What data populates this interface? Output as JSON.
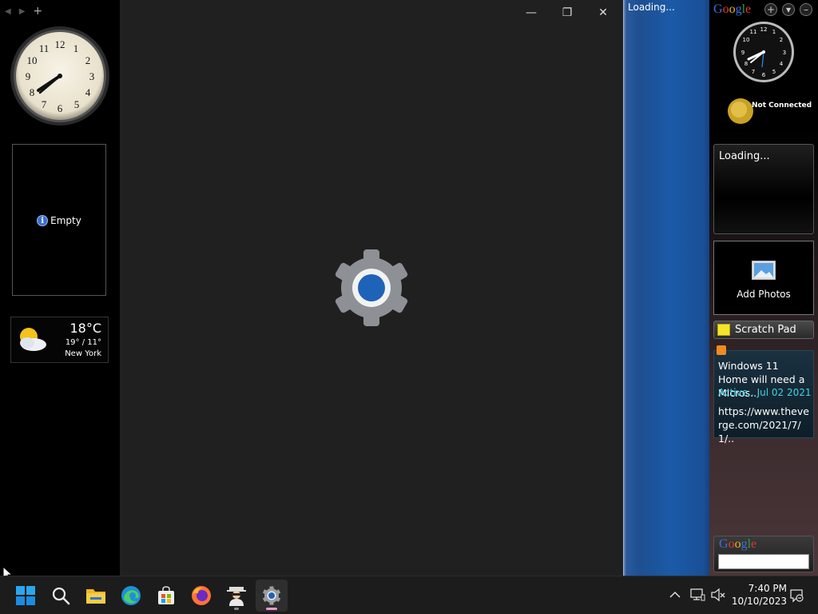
{
  "left_sidebar": {
    "slideshow": {
      "empty_label": "Empty"
    },
    "weather": {
      "temp": "18°C",
      "range": "19° / 11°",
      "city": "New York"
    }
  },
  "settings_window": {
    "minimize_glyph": "—",
    "maximize_glyph": "❐",
    "close_glyph": "✕"
  },
  "blue_panel": {
    "loading_text": "Loading..."
  },
  "google_sidebar": {
    "logo": [
      "G",
      "o",
      "o",
      "g",
      "l",
      "e"
    ],
    "add_glyph": "+",
    "menu_glyph": "▾",
    "collapse_glyph": "–",
    "connection_status": "Not Connected",
    "loading_gadget_text": "Loading...",
    "photos_label": "Add Photos",
    "scratch_pad_label": "Scratch Pad",
    "rss": {
      "headline": "Windows 11 Home will need a Micros..",
      "meta": "Active..   Jul 02 2021",
      "url": "https://www.theverge.com/2021/7/1/.."
    },
    "search": {
      "value": ""
    }
  },
  "taskbar": {
    "apps": [
      {
        "name": "start-button"
      },
      {
        "name": "search-icon"
      },
      {
        "name": "file-explorer-icon"
      },
      {
        "name": "edge-icon"
      },
      {
        "name": "store-icon"
      },
      {
        "name": "firefox-icon"
      },
      {
        "name": "spy-app-icon"
      },
      {
        "name": "settings-icon"
      }
    ],
    "time": "7:40 PM",
    "date": "10/10/2023"
  },
  "colors": {
    "window_bg": "#202020",
    "taskbar_bg": "#1c1c1c",
    "accent_blue": "#1b5aa8",
    "rss_meta": "#3fd4e8"
  }
}
